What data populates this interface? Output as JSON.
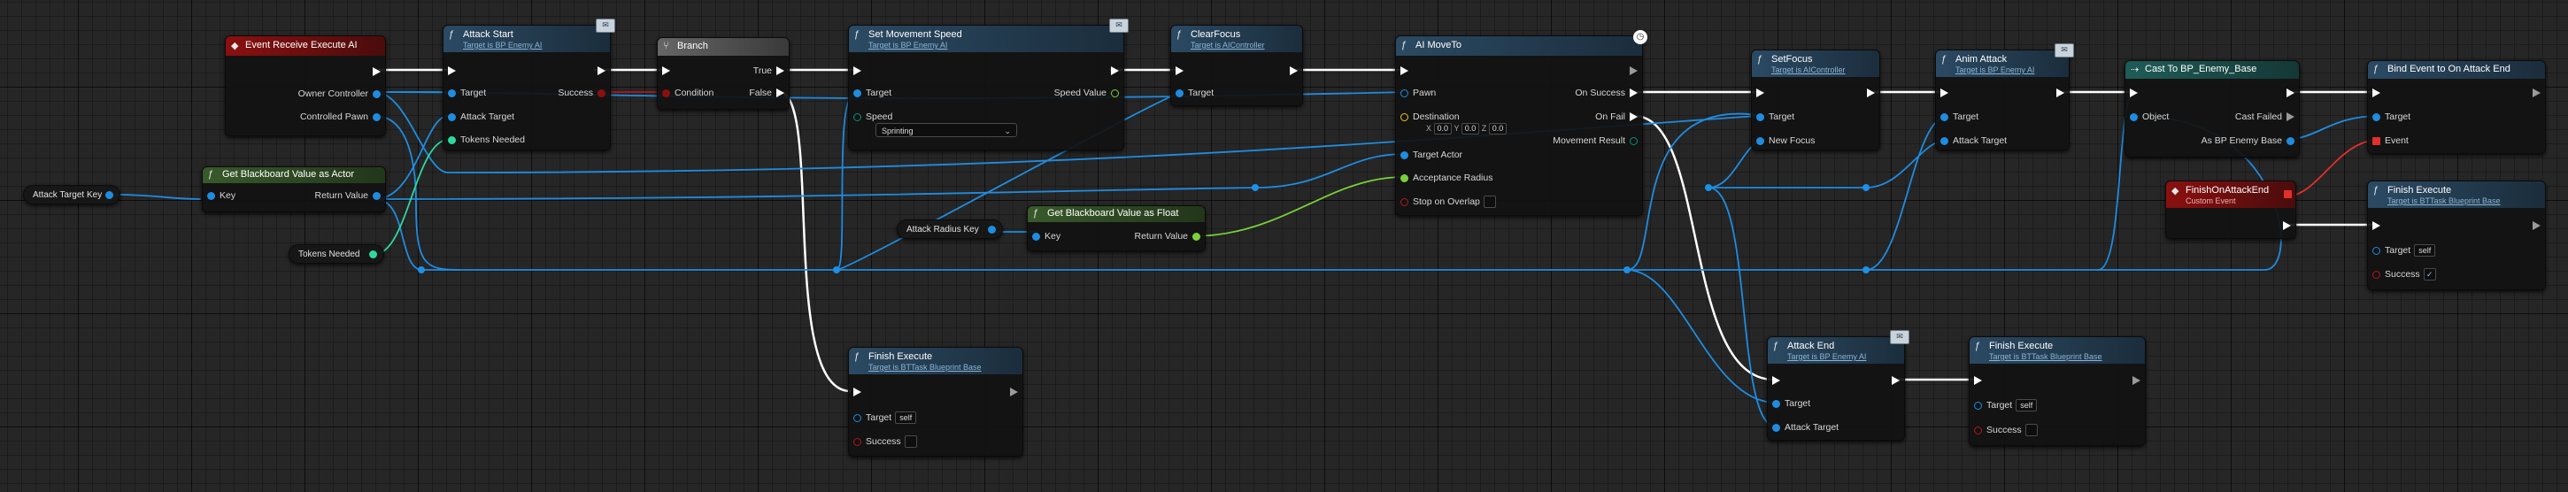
{
  "variables": {
    "attack_target_key": "Attack Target Key",
    "tokens_needed": "Tokens Needed",
    "attack_radius_key": "Attack Radius Key"
  },
  "nodes": {
    "event_receive": {
      "title": "Event Receive Execute AI",
      "owner": "Owner Controller",
      "pawn": "Controlled Pawn"
    },
    "get_bb_actor": {
      "title": "Get Blackboard Value as Actor",
      "key": "Key",
      "ret": "Return Value"
    },
    "attack_start": {
      "title": "Attack Start",
      "subtitle": "Target is BP Enemy AI",
      "target": "Target",
      "attack_target": "Attack Target",
      "tokens": "Tokens Needed",
      "success": "Success"
    },
    "branch": {
      "title": "Branch",
      "condition": "Condition",
      "true_label": "True",
      "false_label": "False"
    },
    "set_speed": {
      "title": "Set Movement Speed",
      "subtitle": "Target is BP Enemy AI",
      "target": "Target",
      "speed": "Speed",
      "speed_value": "Speed Value",
      "speed_option": "Sprinting"
    },
    "clear_focus": {
      "title": "ClearFocus",
      "subtitle": "Target is AIController",
      "target": "Target"
    },
    "get_bb_float": {
      "title": "Get Blackboard Value as Float",
      "key": "Key",
      "ret": "Return Value"
    },
    "ai_move_to": {
      "title": "AI MoveTo",
      "pawn": "Pawn",
      "destination": "Destination",
      "x": "X",
      "y": "Y",
      "z": "Z",
      "xv": "0.0",
      "yv": "0.0",
      "zv": "0.0",
      "target_actor": "Target Actor",
      "acceptance": "Acceptance Radius",
      "stop": "Stop on Overlap",
      "on_success": "On Success",
      "on_fail": "On Fail",
      "move_result": "Movement Result"
    },
    "set_focus": {
      "title": "SetFocus",
      "subtitle": "Target is AIController",
      "target": "Target",
      "new_focus": "New Focus"
    },
    "anim_attack": {
      "title": "Anim Attack",
      "subtitle": "Target is BP Enemy AI",
      "target": "Target",
      "attack_target": "Attack Target"
    },
    "cast": {
      "title": "Cast To BP_Enemy_Base",
      "object": "Object",
      "cast_failed": "Cast Failed",
      "as_bp": "As BP Enemy Base"
    },
    "bind_event": {
      "title": "Bind Event to On Attack End",
      "target": "Target",
      "event": "Event"
    },
    "finish_on_attack": {
      "title": "FinishOnAttackEnd",
      "subtitle": "Custom Event"
    },
    "finish_exec_right": {
      "title": "Finish Execute",
      "subtitle": "Target is BTTask Blueprint Base",
      "target": "Target",
      "self": "self",
      "success": "Success"
    },
    "finish_exec_bottom": {
      "title": "Finish Execute",
      "subtitle": "Target is BTTask Blueprint Base",
      "target": "Target",
      "self": "self",
      "success": "Success"
    },
    "attack_end": {
      "title": "Attack End",
      "subtitle": "Target is BP Enemy AI",
      "target": "Target",
      "attack_target": "Attack Target"
    },
    "finish_exec_mid": {
      "title": "Finish Execute",
      "subtitle": "Target is BTTask Blueprint Base",
      "target": "Target",
      "self": "self",
      "success": "Success"
    }
  },
  "colors": {
    "exec": "#ffffff",
    "object": "#1f8ce0",
    "boolean": "#8c0f0f",
    "integer": "#2fd7a0",
    "float": "#7ad03a",
    "vector": "#f2c318",
    "event_header": "#8a1010",
    "function_header": "#2b4a63",
    "pure_header": "#385a2a",
    "branch_header": "#555555",
    "cast_header": "#1f5c58"
  },
  "icons": {
    "function": "function-icon",
    "event": "event-icon",
    "branch": "branch-icon",
    "cast": "cast-icon",
    "message": "message-icon",
    "latent": "clock-icon"
  }
}
